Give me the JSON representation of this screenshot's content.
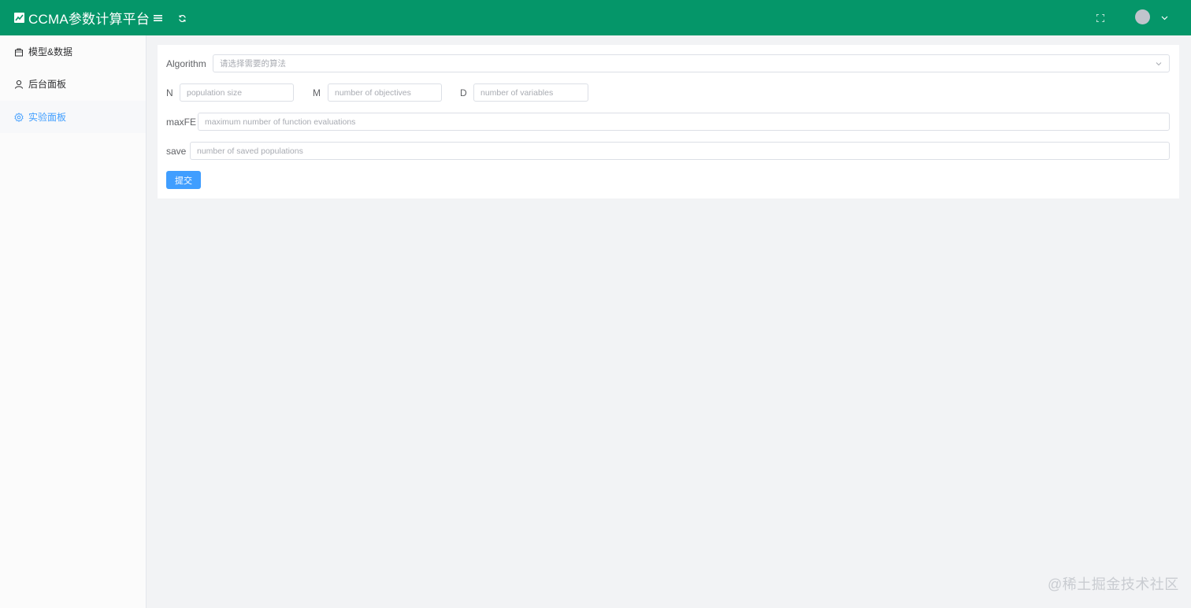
{
  "header": {
    "title": "CCMA参数计算平台",
    "bg_color": "#059669",
    "icons": [
      "chart-icon",
      "menu-icon",
      "refresh-icon",
      "fullscreen-icon",
      "avatar",
      "chevron-down-icon"
    ]
  },
  "sidebar": {
    "items": [
      {
        "label": "模型&数据",
        "icon": "bag-icon",
        "active": false
      },
      {
        "label": "后台面板",
        "icon": "user-icon",
        "active": false
      },
      {
        "label": "实验面板",
        "icon": "gear-icon",
        "active": true
      }
    ],
    "active_color": "#409eff"
  },
  "form": {
    "algorithm": {
      "label": "Algorithm",
      "placeholder": "请选择需要的算法"
    },
    "n": {
      "label": "N",
      "placeholder": "population size"
    },
    "m": {
      "label": "M",
      "placeholder": "number of objectives"
    },
    "d": {
      "label": "D",
      "placeholder": "number of variables"
    },
    "maxfe": {
      "label": "maxFE",
      "placeholder": "maximum number of function evaluations"
    },
    "save": {
      "label": "save",
      "placeholder": "number of saved populations"
    },
    "submit_label": "提交"
  },
  "watermark": "@稀土掘金技术社区"
}
